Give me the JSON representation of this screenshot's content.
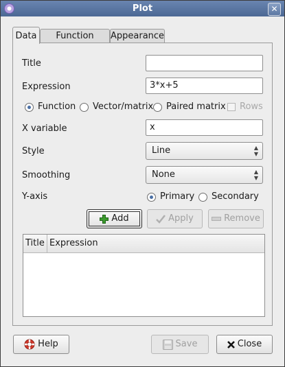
{
  "window": {
    "title": "Plot"
  },
  "tabs": [
    {
      "label": "Data",
      "active": true
    },
    {
      "label": "Function Range",
      "active": false
    },
    {
      "label": "Appearance",
      "active": false
    }
  ],
  "form": {
    "title_label": "Title",
    "title_value": "",
    "expression_label": "Expression",
    "expression_value": "3*x+5",
    "type_options": [
      {
        "label": "Function",
        "selected": true
      },
      {
        "label": "Vector/matrix",
        "selected": false
      },
      {
        "label": "Paired matrix",
        "selected": false
      }
    ],
    "rows_label": "Rows",
    "x_variable_label": "X variable",
    "x_variable_value": "x",
    "style_label": "Style",
    "style_value": "Line",
    "smoothing_label": "Smoothing",
    "smoothing_value": "None",
    "yaxis_label": "Y-axis",
    "yaxis_options": [
      {
        "label": "Primary",
        "selected": true
      },
      {
        "label": "Secondary",
        "selected": false
      }
    ]
  },
  "actions": {
    "add": "Add",
    "apply": "Apply",
    "remove": "Remove"
  },
  "table": {
    "columns": [
      "Title",
      "Expression"
    ],
    "rows": []
  },
  "footer": {
    "help": "Help",
    "save": "Save",
    "close": "Close"
  },
  "icons": {
    "app": "app-icon",
    "add": "plus-icon",
    "apply": "checkmark-icon",
    "remove": "minus-icon",
    "help": "lifebuoy-icon",
    "save": "floppy-icon",
    "close": "x-icon"
  },
  "colors": {
    "titlebar": "#5672a0",
    "selection_accent": "#4a6fa5",
    "add_icon": "#3c9a2e",
    "help_icon": "#d2382b"
  }
}
